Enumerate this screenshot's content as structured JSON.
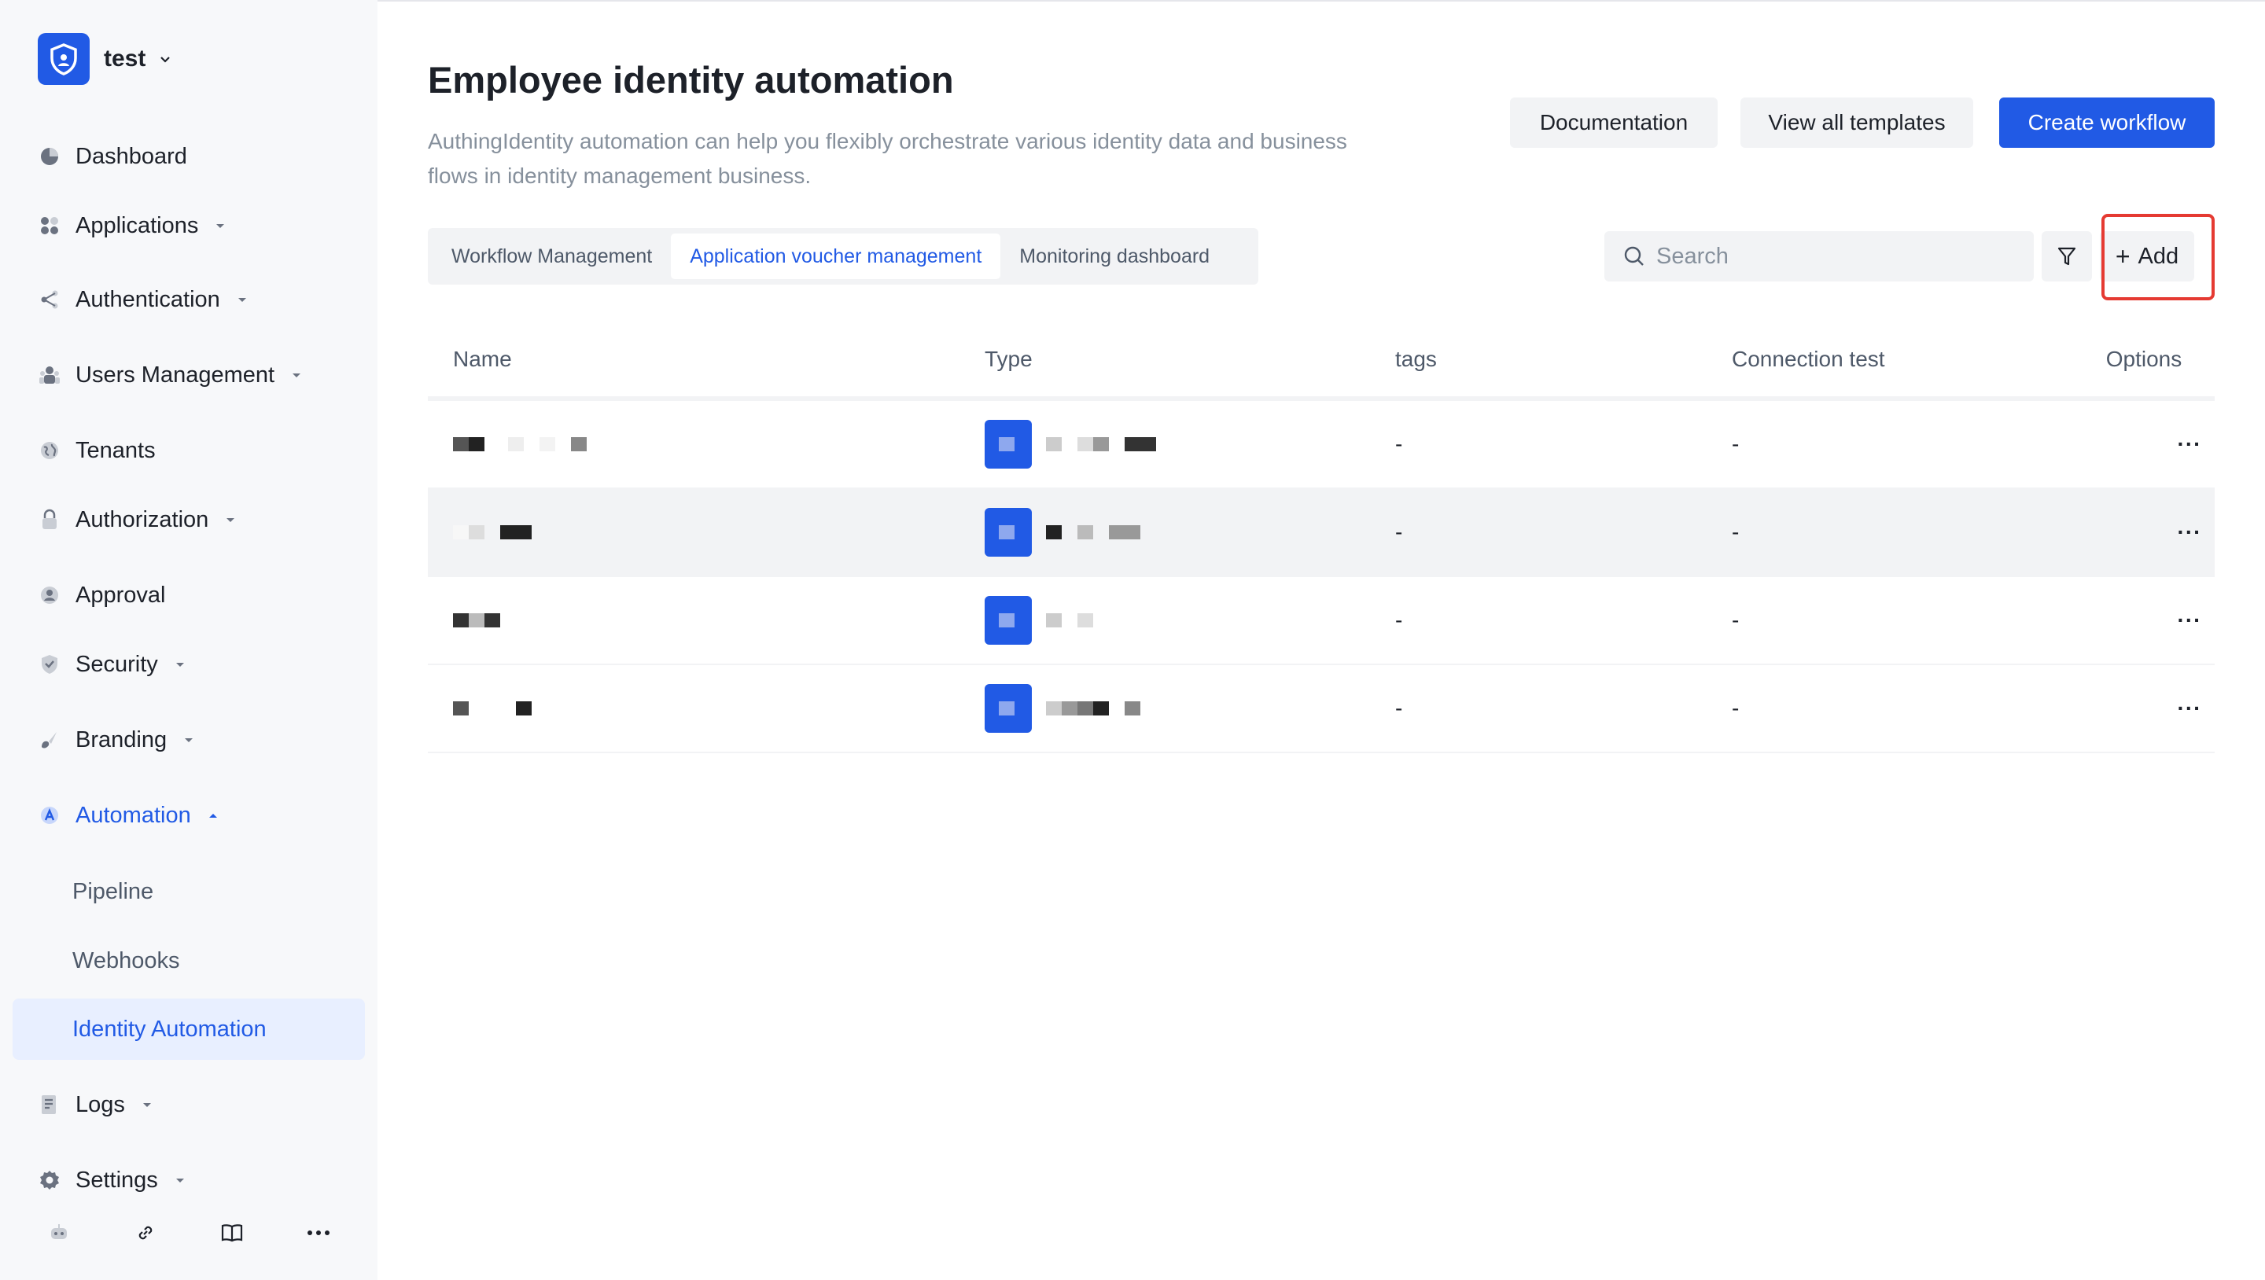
{
  "tenant": {
    "name": "test"
  },
  "sidebar": {
    "items": [
      {
        "label": "Dashboard",
        "icon": "pie-chart-icon"
      },
      {
        "label": "Applications",
        "icon": "apps-grid-icon"
      },
      {
        "label": "Authentication",
        "icon": "share-nodes-icon"
      },
      {
        "label": "Users Management",
        "icon": "users-icon"
      },
      {
        "label": "Tenants",
        "icon": "globe-icon"
      },
      {
        "label": "Authorization",
        "icon": "lock-icon"
      },
      {
        "label": "Approval",
        "icon": "approval-icon"
      },
      {
        "label": "Security",
        "icon": "shield-icon"
      },
      {
        "label": "Branding",
        "icon": "brush-icon"
      },
      {
        "label": "Automation",
        "icon": "automation-icon"
      },
      {
        "label": "Logs",
        "icon": "document-icon"
      },
      {
        "label": "Settings",
        "icon": "gear-icon"
      }
    ],
    "sub_items": [
      {
        "label": "Pipeline"
      },
      {
        "label": "Webhooks"
      },
      {
        "label": "Identity Automation"
      }
    ],
    "bottom_icons": [
      "robot-icon",
      "link-icon",
      "book-icon",
      "more-icon"
    ]
  },
  "header": {
    "title": "Employee identity automation",
    "description": "AuthingIdentity automation can help you flexibly orchestrate various identity data and business flows in identity management business.",
    "documentation_label": "Documentation",
    "templates_label": "View all templates",
    "create_label": "Create workflow"
  },
  "tabs": [
    {
      "label": "Workflow Management"
    },
    {
      "label": "Application voucher management"
    },
    {
      "label": "Monitoring dashboard"
    }
  ],
  "toolbar": {
    "search_placeholder": "Search",
    "add_label": "Add"
  },
  "table": {
    "columns": [
      "Name",
      "Type",
      "tags",
      "Connection test",
      "Options"
    ],
    "rows": [
      {
        "tags": "-",
        "connection": "-",
        "options": "···"
      },
      {
        "tags": "-",
        "connection": "-",
        "options": "···"
      },
      {
        "tags": "-",
        "connection": "-",
        "options": "···"
      },
      {
        "tags": "-",
        "connection": "-",
        "options": "···"
      }
    ]
  },
  "colors": {
    "accent": "#215ae5",
    "highlight": "#e53a32"
  }
}
